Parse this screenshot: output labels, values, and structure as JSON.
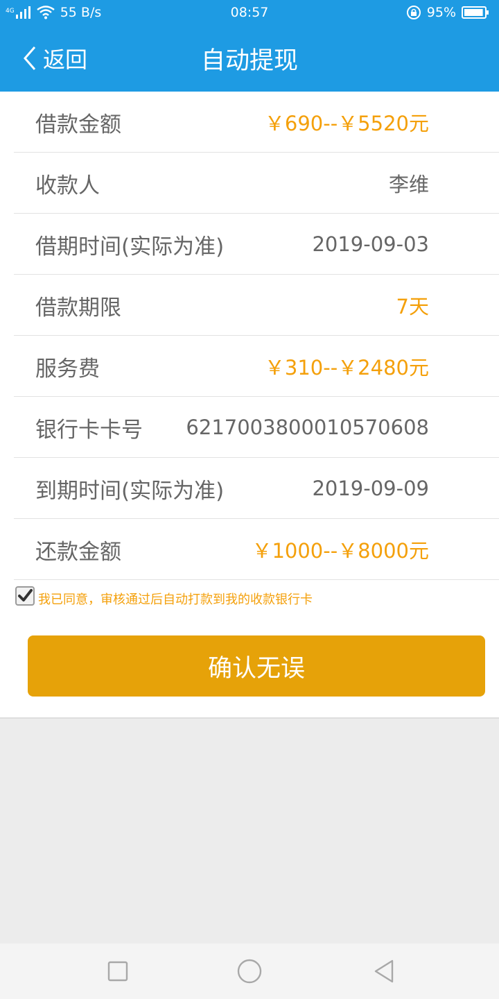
{
  "status_bar": {
    "network_label": "4G",
    "speed": "55 B/s",
    "time": "08:57",
    "battery_percent": "95%",
    "battery_level": 0.95
  },
  "nav": {
    "back_label": "返回",
    "title": "自动提现"
  },
  "rows": [
    {
      "label": "借款金额",
      "value": "￥690--￥5520元",
      "accent": true
    },
    {
      "label": "收款人",
      "value": "李维",
      "accent": false
    },
    {
      "label": "借期时间(实际为准)",
      "value": "2019-09-03",
      "accent": false
    },
    {
      "label": "借款期限",
      "value": "7天",
      "accent": true
    },
    {
      "label": "服务费",
      "value": "￥310--￥2480元",
      "accent": true
    },
    {
      "label": "银行卡卡号",
      "value": "6217003800010570608",
      "accent": false
    },
    {
      "label": "到期时间(实际为准)",
      "value": "2019-09-09",
      "accent": false
    },
    {
      "label": "还款金额",
      "value": "￥1000--￥8000元",
      "accent": true
    }
  ],
  "agreement": {
    "checked": true,
    "text": "我已同意，审核通过后自动打款到我的收款银行卡"
  },
  "confirm_label": "确认无误",
  "colors": {
    "header": "#1e9be3",
    "accent_text": "#f4a00b",
    "button": "#e6a209",
    "label_text": "#666666"
  },
  "icons": {
    "signal": "signal-icon",
    "wifi": "wifi-icon",
    "rotation_lock": "rotation-lock-icon",
    "battery": "battery-icon",
    "back": "chevron-left-icon",
    "check": "checkmark-icon",
    "recent": "square-icon",
    "home": "circle-icon",
    "sys_back": "triangle-back-icon"
  }
}
